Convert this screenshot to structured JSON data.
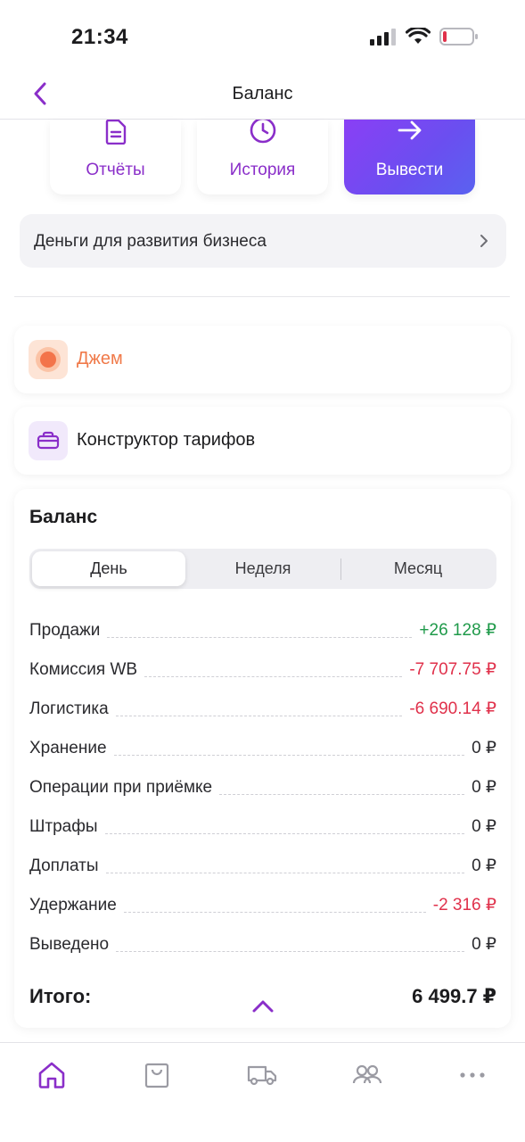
{
  "status": {
    "time": "21:34"
  },
  "nav": {
    "title": "Баланс"
  },
  "actions": [
    {
      "label": "Отчёты",
      "icon": "document-icon"
    },
    {
      "label": "История",
      "icon": "clock-icon"
    },
    {
      "label": "Вывести",
      "icon": "arrow-right-icon"
    }
  ],
  "business": {
    "label": "Деньги для развития бизнеса"
  },
  "jam": {
    "label": "Джем"
  },
  "tariffs": {
    "label": "Конструктор тарифов"
  },
  "balance": {
    "title": "Баланс",
    "tabs": [
      "День",
      "Неделя",
      "Месяц"
    ],
    "active_tab": "День",
    "rows": [
      {
        "label": "Продажи",
        "value": "+26 128 ₽",
        "tone": "positive"
      },
      {
        "label": "Комиссия WB",
        "value": "-7 707.75 ₽",
        "tone": "negative"
      },
      {
        "label": "Логистика",
        "value": "-6 690.14 ₽",
        "tone": "negative"
      },
      {
        "label": "Хранение",
        "value": "0 ₽",
        "tone": "neutral"
      },
      {
        "label": "Операции при приёмке",
        "value": "0 ₽",
        "tone": "neutral"
      },
      {
        "label": "Штрафы",
        "value": "0 ₽",
        "tone": "neutral"
      },
      {
        "label": "Доплаты",
        "value": "0 ₽",
        "tone": "neutral"
      },
      {
        "label": "Удержание",
        "value": "-2 316 ₽",
        "tone": "negative"
      },
      {
        "label": "Выведено",
        "value": "0 ₽",
        "tone": "neutral"
      }
    ],
    "total_label": "Итого:",
    "total_value": "6 499.7 ₽"
  },
  "tabbar": [
    "home-icon",
    "bag-icon",
    "truck-icon",
    "users-icon",
    "more-icon"
  ],
  "colors": {
    "accent": "#8a2ec9",
    "positive": "#1f9a4a",
    "negative": "#e0314b",
    "jam": "#f07a4a"
  }
}
